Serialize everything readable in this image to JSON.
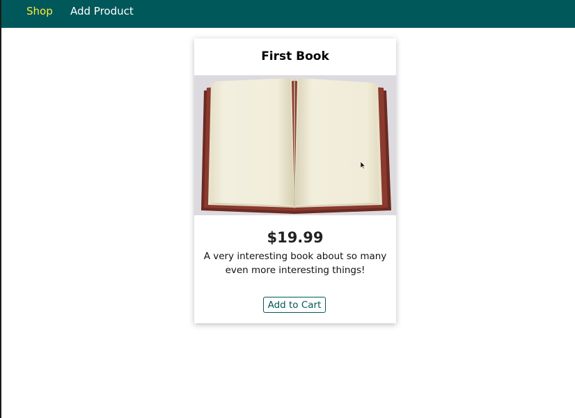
{
  "nav": {
    "shop_label": "Shop",
    "add_product_label": "Add Product"
  },
  "product": {
    "title": "First Book",
    "price": "$19.99",
    "description": "A very interesting book about so many even more interesting things!",
    "add_to_cart_label": "Add to Cart"
  },
  "colors": {
    "header_bg": "#00585a",
    "active_nav": "#ffeb3b",
    "nav_text": "#ffffff",
    "button_border": "#00585a"
  }
}
